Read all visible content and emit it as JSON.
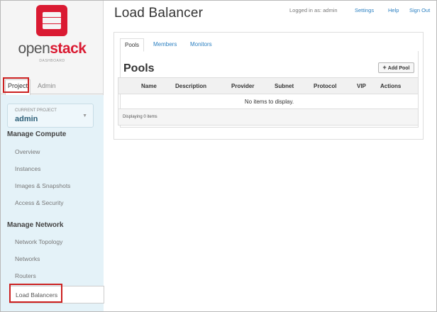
{
  "brand": {
    "name_part1": "open",
    "name_part2": "stack",
    "subtitle": "DASHBOARD"
  },
  "sidebar": {
    "tabs": [
      {
        "label": "Project"
      },
      {
        "label": "Admin"
      }
    ],
    "current_project": {
      "caption": "CURRENT PROJECT",
      "name": "admin"
    },
    "sections": [
      {
        "title": "Manage Compute",
        "items": [
          "Overview",
          "Instances",
          "Images & Snapshots",
          "Access & Security"
        ]
      },
      {
        "title": "Manage Network",
        "items": [
          "Network Topology",
          "Networks",
          "Routers",
          "Load Balancers"
        ]
      }
    ]
  },
  "header": {
    "title": "Load Balancer",
    "logged_in": "Logged in as: admin",
    "links": [
      "Settings",
      "Help",
      "Sign Out"
    ]
  },
  "main": {
    "tabs": [
      {
        "label": "Pools"
      },
      {
        "label": "Members"
      },
      {
        "label": "Monitors"
      }
    ],
    "heading": "Pools",
    "add_button": {
      "icon": "plus-icon",
      "label": "Add Pool"
    },
    "table": {
      "columns": [
        "Name",
        "Description",
        "Provider",
        "Subnet",
        "Protocol",
        "VIP",
        "Actions"
      ],
      "empty_message": "No items to display.",
      "footer": "Displaying 0 items"
    }
  },
  "colors": {
    "brand_red": "#da1a32",
    "link_blue": "#2a7fc1",
    "highlight_red": "#cc2020",
    "nav_bg": "#e4f2f8"
  }
}
